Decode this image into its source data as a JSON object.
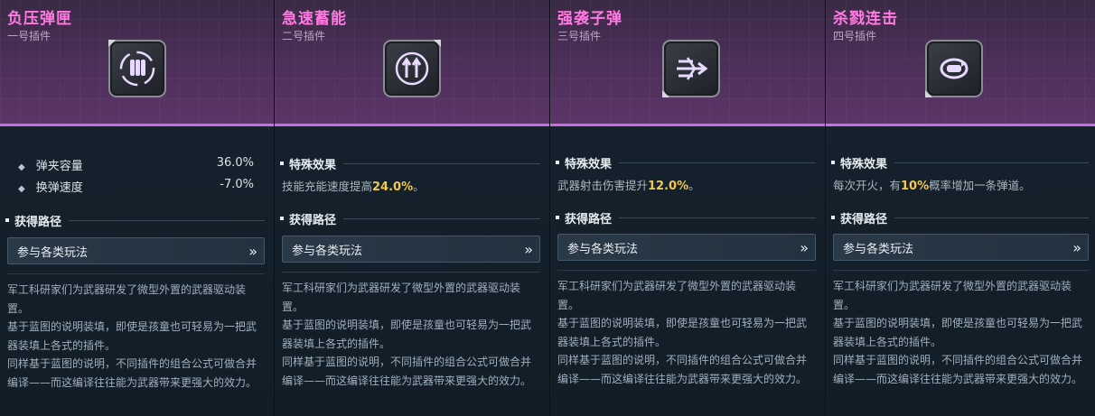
{
  "cards": [
    {
      "title": "负压弹匣",
      "subtitle": "一号插件",
      "icon": "bullets-cycle-icon",
      "stats": [
        {
          "label": "弹夹容量",
          "value": "36.0%"
        },
        {
          "label": "换弹速度",
          "value": "-7.0%"
        }
      ],
      "route_label": "获得路径",
      "route_button": "参与各类玩法",
      "route_chevron": "»",
      "description": [
        "军工科研家们为武器研发了微型外置的武器驱动装置。",
        "基于蓝图的说明装填，即使是孩童也可轻易为一把武器装填上各式的插件。",
        "同样基于蓝图的说明，不同插件的组合公式可做合并编译——而这编译往往能为武器带来更强大的效力。"
      ]
    },
    {
      "title": "急速蓄能",
      "subtitle": "二号插件",
      "icon": "charge-arrows-icon",
      "effect_label": "特殊效果",
      "effect_text_pre": "技能充能速度提高",
      "effect_value": "24.0%",
      "effect_text_post": "。",
      "route_label": "获得路径",
      "route_button": "参与各类玩法",
      "route_chevron": "»",
      "description": [
        "军工科研家们为武器研发了微型外置的武器驱动装置。",
        "基于蓝图的说明装填，即使是孩童也可轻易为一把武器装填上各式的插件。",
        "同样基于蓝图的说明，不同插件的组合公式可做合并编译——而这编译往往能为武器带来更强大的效力。"
      ]
    },
    {
      "title": "强袭子弹",
      "subtitle": "三号插件",
      "icon": "piercing-bullet-icon",
      "effect_label": "特殊效果",
      "effect_text_pre": "武器射击伤害提升",
      "effect_value": "12.0%",
      "effect_text_post": "。",
      "route_label": "获得路径",
      "route_button": "参与各类玩法",
      "route_chevron": "»",
      "description": [
        "军工科研家们为武器研发了微型外置的武器驱动装置。",
        "基于蓝图的说明装填，即使是孩童也可轻易为一把武器装填上各式的插件。",
        "同样基于蓝图的说明，不同插件的组合公式可做合并编译——而这编译往往能为武器带来更强大的效力。"
      ]
    },
    {
      "title": "杀戮连击",
      "subtitle": "四号插件",
      "icon": "bullet-loop-icon",
      "effect_label": "特殊效果",
      "effect_text_pre": "每次开火，有",
      "effect_value": "10%",
      "effect_text_post": "概率增加一条弹道。",
      "route_label": "获得路径",
      "route_button": "参与各类玩法",
      "route_chevron": "»",
      "description": [
        "军工科研家们为武器研发了微型外置的武器驱动装置。",
        "基于蓝图的说明装填，即使是孩童也可轻易为一把武器装填上各式的插件。",
        "同样基于蓝图的说明，不同插件的组合公式可做合并编译——而这编译往往能为武器带来更强大的效力。"
      ]
    }
  ]
}
